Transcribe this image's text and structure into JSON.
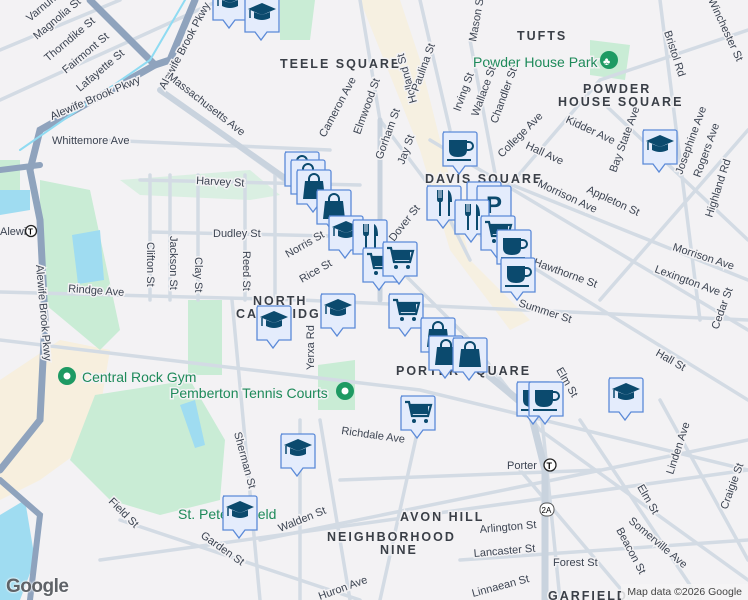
{
  "map": {
    "neighborhoods": [
      "TEELE SQUARE",
      "TUFTS",
      "POWDER",
      "HOUSE SQUARE",
      "DAVIS SQUARE",
      "NORTH",
      "CAMBRIDGE",
      "PORTER SQUARE",
      "AVON HILL",
      "NEIGHBORHOOD",
      "NINE",
      "GARFIELD"
    ],
    "pois": [
      "Powder House Park",
      "Central Rock Gym",
      "Pemberton Tennis Courts",
      "St. Peter's Field"
    ],
    "transit": [
      "Alewife",
      "Porter"
    ],
    "route_shield": "2A",
    "streets": [
      "Alewife Brook Pkwy",
      "Alewife Brook Pkwy",
      "Alewife Brook Pkwy",
      "Massachusetts Ave",
      "Whittemore Ave",
      "Harvey St",
      "Dudley St",
      "Rindge Ave",
      "Clifton St",
      "Jackson St",
      "Clay St",
      "Reed St",
      "Norris St",
      "Rice St",
      "Yerxa Rd",
      "Magnolia St",
      "Thorndike St",
      "Fairmont St",
      "Lafayette St",
      "Varnum St",
      "Holland St",
      "Elmwood St",
      "Gorham St",
      "Jay St",
      "Paulina St",
      "Irving St",
      "Wallace St",
      "Chandler St",
      "Mason St",
      "College Ave",
      "Kidder Ave",
      "Hall Ave",
      "Morrison Ave",
      "Appleton St",
      "Bay State Ave",
      "Josephine Ave",
      "Rogers Ave",
      "Highland Rd",
      "Bristol Rd",
      "Winchester St",
      "Morrison Ave",
      "Lexington Ave",
      "Hawthorne St",
      "Elm St",
      "Elm St",
      "Hall St",
      "Cedar St",
      "Linden Ave",
      "Richdale Ave",
      "Sherman St",
      "Walden St",
      "Garden St",
      "Field St",
      "Huron Ave",
      "Arlington St",
      "Lancaster St",
      "Forest St",
      "Linnaean St",
      "Somerville Ave",
      "Beacon St",
      "Craigie St",
      "Dover St",
      "Summer St",
      "Cameron Ave"
    ],
    "markers": [
      "school",
      "school",
      "shopping",
      "shopping",
      "shopping",
      "shopping",
      "school",
      "restaurant",
      "grocery",
      "grocery",
      "cafe",
      "restaurant",
      "parking",
      "parking",
      "restaurant",
      "grocery",
      "cafe",
      "cafe",
      "school",
      "school",
      "grocery",
      "shopping",
      "shopping",
      "shopping",
      "grocery",
      "cafe",
      "cafe",
      "school",
      "school",
      "school",
      "school"
    ],
    "colors": {
      "marker_fill": "#e4ecfc",
      "marker_border": "#5b8ad8",
      "icon": "#0b4a6e",
      "park": "#c9ecd5",
      "water": "#9fdcf1",
      "highway": "#8fa3bd",
      "poi_green": "#1e9a63"
    }
  },
  "footer": {
    "logo": "Google",
    "attribution": "Map data ©2026 Google"
  }
}
